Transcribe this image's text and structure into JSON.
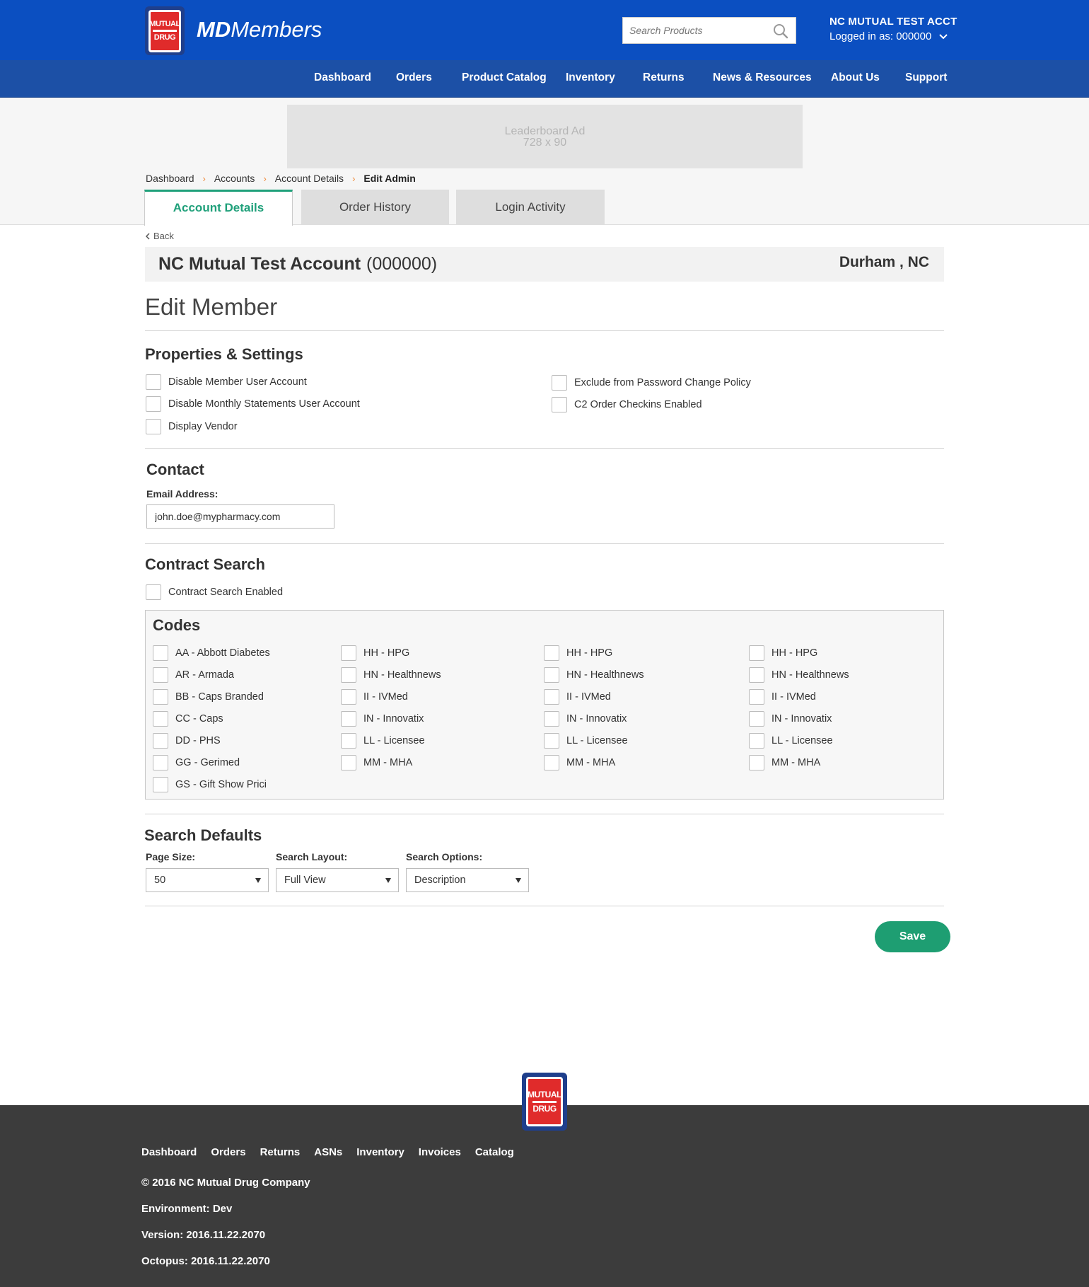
{
  "header": {
    "logo_text": [
      "MUTUAL",
      "DRUG"
    ],
    "brand_md": "MD",
    "brand_rest": "Members",
    "search_placeholder": "Search Products",
    "account_name": "NC MUTUAL TEST ACCT",
    "logged_in": "Logged in as: 000000"
  },
  "nav": [
    "Dashboard",
    "Orders",
    "Product Catalog",
    "Inventory",
    "Returns",
    "News & Resources",
    "About Us",
    "Support"
  ],
  "ad": {
    "line1": "Leaderboard Ad",
    "line2": "728 x 90"
  },
  "breadcrumb": [
    "Dashboard",
    "Accounts",
    "Account Details",
    "Edit Admin"
  ],
  "tabs": [
    "Account Details",
    "Order History",
    "Login Activity"
  ],
  "back_label": "Back",
  "account": {
    "name": "NC Mutual Test Account",
    "number": "(000000)",
    "location": "Durham , NC"
  },
  "page_title": "Edit Member",
  "properties": {
    "title": "Properties & Settings",
    "left": [
      "Disable Member User Account",
      "Disable Monthly Statements User Account",
      "Display Vendor"
    ],
    "right": [
      "Exclude from Password Change Policy",
      "C2 Order Checkins Enabled"
    ]
  },
  "contact": {
    "title": "Contact",
    "email_label": "Email Address:",
    "email_value": "john.doe@mypharmacy.com"
  },
  "contract": {
    "title": "Contract Search",
    "enabled_label": "Contract Search Enabled",
    "codes_title": "Codes",
    "col1": [
      "AA - Abbott Diabetes",
      "AR - Armada",
      "BB - Caps Branded",
      "CC - Caps",
      "DD - PHS",
      "GG - Gerimed",
      "GS  - Gift Show Prici"
    ],
    "col2": [
      "HH - HPG",
      "HN - Healthnews",
      "II - IVMed",
      "IN - Innovatix",
      "LL - Licensee",
      "MM - MHA"
    ],
    "col3": [
      "HH - HPG",
      "HN - Healthnews",
      "II - IVMed",
      "IN - Innovatix",
      "LL - Licensee",
      "MM - MHA"
    ],
    "col4": [
      "HH - HPG",
      "HN - Healthnews",
      "II - IVMed",
      "IN - Innovatix",
      "LL - Licensee",
      "MM - MHA"
    ]
  },
  "search_defaults": {
    "title": "Search Defaults",
    "page_size_label": "Page Size:",
    "page_size_value": "50",
    "layout_label": "Search Layout:",
    "layout_value": "Full View",
    "options_label": "Search Options:",
    "options_value": "Description"
  },
  "save_label": "Save",
  "footer": {
    "links": [
      "Dashboard",
      "Orders",
      "Returns",
      "ASNs",
      "Inventory",
      "Invoices",
      "Catalog"
    ],
    "copyright": "© 2016 NC Mutual Drug Company",
    "environment": "Environment: Dev",
    "version": "Version: 2016.11.22.2070",
    "octopus": "Octopus: 2016.11.22.2070"
  },
  "colors": {
    "header_blue": "#0b4fc1",
    "nav_blue": "#1c50a6",
    "accent_green": "#1e9e72",
    "footer_bg": "#3c3c3c",
    "crumb_arrow": "#f08a3a"
  }
}
